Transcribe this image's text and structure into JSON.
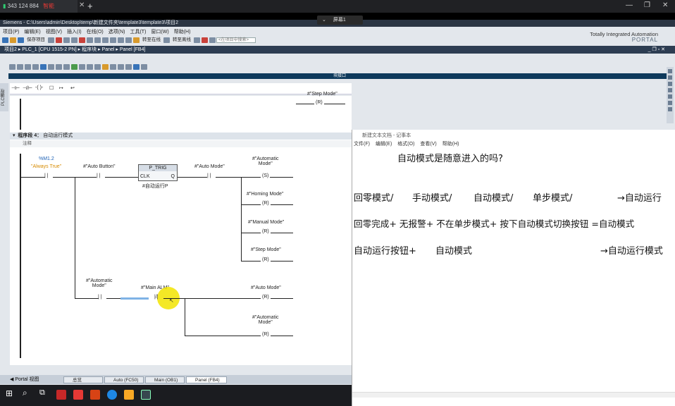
{
  "remote": {
    "tab_label": "343 124 884",
    "tab_badge": "智能",
    "screen_label": "屏幕1"
  },
  "tia": {
    "title": "Siemens  -  C:\\Users\\admin\\Desktop\\temp\\新建文件夹\\template3\\template3\\项目2",
    "menu": [
      "项目(P)",
      "编辑(E)",
      "视图(V)",
      "插入(I)",
      "在线(O)",
      "选项(N)",
      "工具(T)",
      "窗口(W)",
      "帮助(H)"
    ],
    "brand_line1": "Totally Integrated Automation",
    "brand_line2": "PORTAL",
    "save_label": "保存项目",
    "go_online": "转至在线",
    "go_offline": "转至离线",
    "search_placeholder": "<在项目中搜索>",
    "breadcrumb": "项目2  ▸  PLC_1 [CPU 1515-2 PN]  ▸  程序块  ▸  Panel  ▸  Panel [FB4]",
    "block_interface": "块接口",
    "sidebar_label": "PLC编程",
    "net3_coil_label": "#\"Step Mode\"",
    "network4_title": "程序段 4：",
    "network4_name": "自动运行模式",
    "comment_label": "注释",
    "ladder": {
      "always_true_addr": "%M1.2",
      "always_true_name": "\"Always True\"",
      "auto_button": "#\"Auto Button\"",
      "ptrig_name": "P_TRIG",
      "ptrig_clk": "CLK",
      "ptrig_q": "Q",
      "ptrig_tag": "#自动运行P",
      "auto_mode_contact": "#\"Auto Mode\"",
      "automatic_mode_coil": "#\"Automatic\nMode\"",
      "homing_mode": "#\"Homing Mode\"",
      "manual_mode": "#\"Manual Mode\"",
      "step_mode": "#\"Step Mode\"",
      "automatic_mode_contact": "#\"Automatic\nMode\"",
      "main_alm": "#\"Main ALM\"",
      "auto_mode_coil2": "#\"Auto Mode\"",
      "automatic_mode_coil2": "#\"Automatic\nMode\"",
      "coil_set": "S",
      "coil_reset": "R"
    },
    "portal_view": "Portal 视图",
    "tabs": [
      "总览",
      "Auto (FC50)",
      "Main (OB1)",
      "Panel (FB4)"
    ]
  },
  "notepad": {
    "title": "新建文本文档 - 记事本",
    "menu": [
      "文件(F)",
      "编辑(E)",
      "格式(O)",
      "查看(V)",
      "帮助(H)"
    ],
    "line1": "自动模式是随意进入的吗?",
    "line2a": "回零模式/",
    "line2b": "手动模式/",
    "line2c": "自动模式/",
    "line2d": "单步模式/",
    "line2e": "→自动运行",
    "line3": "回零完成+ 无报警+ 不在单步模式+ 按下自动模式切换按钮  =自动模式",
    "line4a": "自动运行按钮+",
    "line4b": "自动模式",
    "line4c": "→自动运行模式"
  }
}
